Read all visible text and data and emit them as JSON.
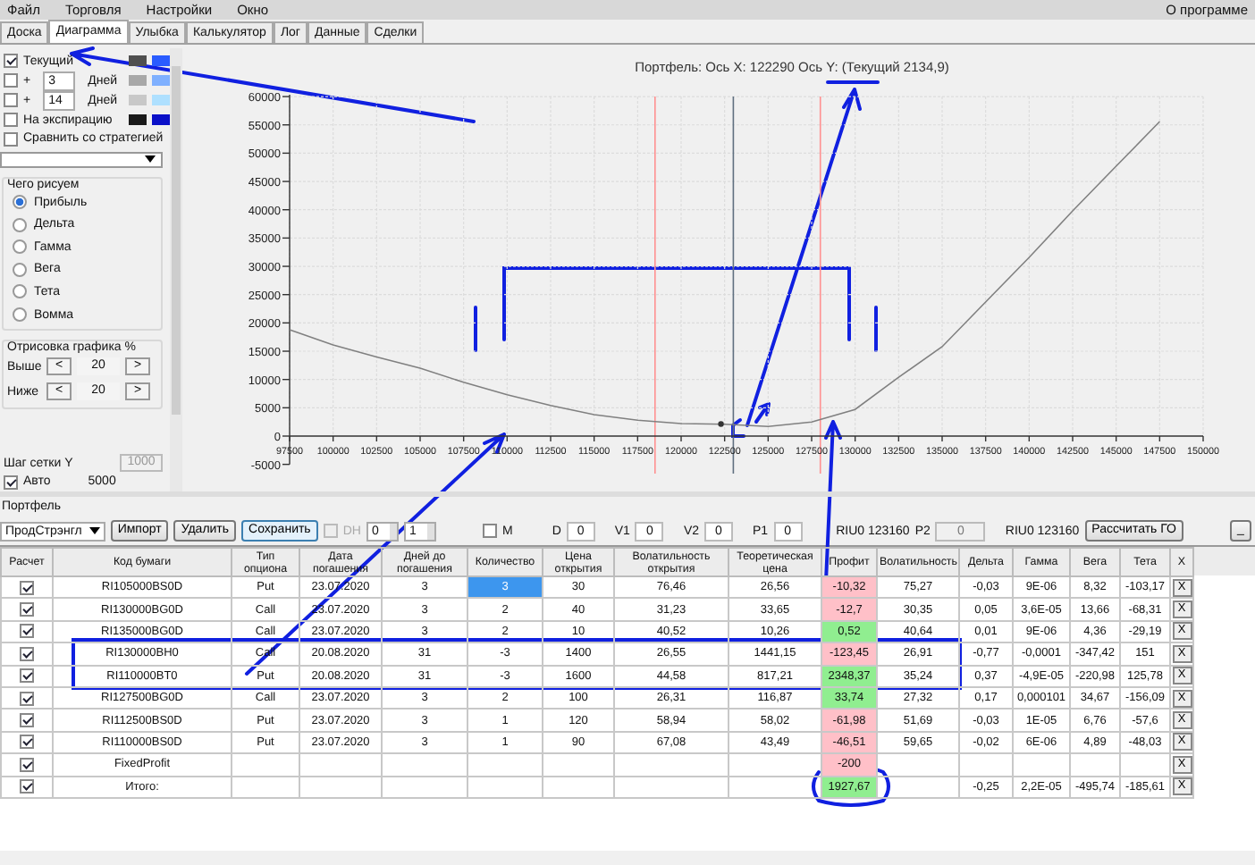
{
  "menu": [
    "Файл",
    "Торговля",
    "Настройки",
    "Окно"
  ],
  "menu_right": "О программе",
  "tabs": [
    {
      "label": "Доска",
      "selected": false
    },
    {
      "label": "Диаграмма",
      "selected": true
    },
    {
      "label": "Улыбка",
      "selected": false
    },
    {
      "label": "Калькулятор",
      "selected": false
    },
    {
      "label": "Лог",
      "selected": false
    },
    {
      "label": "Данные",
      "selected": false
    },
    {
      "label": "Сделки",
      "selected": false
    }
  ],
  "curves": [
    {
      "label": "Текущий",
      "checked": true,
      "swatches": [
        {
          "color": "#505050"
        },
        {
          "color": "#2a5cff"
        }
      ]
    },
    {
      "plus": "+",
      "days": "3",
      "unit": "Дней",
      "checked": false,
      "swatches": [
        {
          "color": "#a8a8a8"
        },
        {
          "color": "#7fb0ff"
        }
      ]
    },
    {
      "plus": "+",
      "days": "14",
      "unit": "Дней",
      "checked": false,
      "swatches": [
        {
          "color": "#c8c8c8"
        },
        {
          "color": "#aee0ff"
        }
      ]
    },
    {
      "label": "На экспирацию",
      "checked": false,
      "swatches": [
        {
          "color": "#1a1a1a"
        },
        {
          "color": "#0a10c8"
        }
      ]
    }
  ],
  "compare": {
    "label": "Сравнить со стратегией",
    "checked": false
  },
  "draw_group": {
    "title": "Чего рисуем",
    "options": [
      {
        "label": "Прибыль",
        "selected": true
      },
      {
        "label": "Дельта",
        "selected": false
      },
      {
        "label": "Гамма",
        "selected": false
      },
      {
        "label": "Вега",
        "selected": false
      },
      {
        "label": "Тета",
        "selected": false
      },
      {
        "label": "Вомма",
        "selected": false
      }
    ]
  },
  "range_group": {
    "title": "Отрисовка графика %",
    "rows": [
      {
        "label": "Выше",
        "dec": "<",
        "value": "20",
        "inc": ">"
      },
      {
        "label": "Ниже",
        "dec": "<",
        "value": "20",
        "inc": ">"
      }
    ]
  },
  "grid_step": {
    "label": "Шаг сетки Y",
    "value": "1000",
    "disabled": true,
    "auto_label": "Авто",
    "auto_checked": true,
    "auto_value": "5000"
  },
  "chart": {
    "chart_data": {
      "type": "line",
      "title": "Портфель: Ось X: 122290 Ось Y:  (Текущий 2134,9)",
      "x": [
        97500,
        100000,
        102500,
        105000,
        107500,
        110000,
        112500,
        115000,
        117500,
        120000,
        122500,
        125000,
        127500,
        130000,
        132500,
        135000,
        137500,
        140000,
        142500,
        145000,
        147500
      ],
      "grid": true,
      "ref_lines": [
        {
          "axis": "x",
          "value": 118500,
          "color": "#ff9090"
        },
        {
          "axis": "x",
          "value": 123000,
          "color": "#607080"
        },
        {
          "axis": "x",
          "value": 128000,
          "color": "#ff9090"
        }
      ],
      "series": [
        {
          "color": "#808080",
          "values": [
            18800,
            16100,
            14000,
            12000,
            9500,
            7300,
            5400,
            3800,
            2800,
            2200,
            2100,
            1700,
            2500,
            4700,
            10400,
            15800,
            23700,
            31600,
            39800,
            47700,
            55600
          ]
        }
      ],
      "xlim": [
        97500,
        150000
      ],
      "ylim": [
        -5000,
        60000
      ],
      "xticks": [
        97500,
        100000,
        102500,
        105000,
        107500,
        110000,
        112500,
        115000,
        117500,
        120000,
        122500,
        125000,
        127500,
        130000,
        132500,
        135000,
        137500,
        140000,
        142500,
        145000,
        147500,
        150000
      ],
      "yticks": [
        -5000,
        0,
        5000,
        10000,
        15000,
        20000,
        25000,
        30000,
        35000,
        40000,
        45000,
        50000,
        55000,
        60000
      ]
    }
  },
  "portfolio_label": "Портфель",
  "toolbar": {
    "strategy": "ПродСтрэнгл",
    "buttons": [
      {
        "label": "Импорт",
        "selected": false
      },
      {
        "label": "Удалить",
        "selected": false
      },
      {
        "label": "Сохранить",
        "selected": true
      }
    ],
    "dh": {
      "label": "DH",
      "checked": false,
      "disabled": true
    },
    "spins": [
      "0",
      "1"
    ],
    "m": {
      "label": "M",
      "checked": false
    },
    "params": [
      {
        "label": "D",
        "value": "0"
      },
      {
        "label": "V1",
        "value": "0"
      },
      {
        "label": "V2",
        "value": "0"
      },
      {
        "label": "P1",
        "value": "0"
      }
    ],
    "p1_asset": "RIU0 123160",
    "p2": {
      "label": "P2",
      "value": "0",
      "disabled": true
    },
    "p2_asset": "RIU0 123160",
    "calc_button": "Рассчитать ГО",
    "min_button": "_"
  },
  "table": {
    "columns": [
      "Расчет",
      "Код бумаги",
      "Тип опциона",
      "Дата погашения",
      "Дней до погашения",
      "Количество",
      "Цена открытия",
      "Волатильность открытия",
      "Теоретическая цена",
      "Профит",
      "Волатильность",
      "Дельта",
      "Гамма",
      "Вега",
      "Тета",
      "X"
    ],
    "rows": [
      {
        "calc": true,
        "code": "RI105000BS0D",
        "type": "Put",
        "date": "23.07.2020",
        "days": "3",
        "qty": "3",
        "price": "30",
        "vol_open": "76,46",
        "theo": "26,56",
        "profit": "-10,32",
        "color": "#ffc0c8",
        "vol": "75,27",
        "delta": "-0,03",
        "gamma": "9E-06",
        "vega": "8,32",
        "theta": "-103,17",
        "selected": true,
        "close": "X"
      },
      {
        "calc": true,
        "code": "RI130000BG0D",
        "type": "Call",
        "date": "23.07.2020",
        "days": "3",
        "qty": "2",
        "price": "40",
        "vol_open": "31,23",
        "theo": "33,65",
        "profit": "-12,7",
        "color": "#ffc0c8",
        "vol": "30,35",
        "delta": "0,05",
        "gamma": "3,6E-05",
        "vega": "13,66",
        "theta": "-68,31",
        "selected": false,
        "close": "X"
      },
      {
        "calc": true,
        "code": "RI135000BG0D",
        "type": "Call",
        "date": "23.07.2020",
        "days": "3",
        "qty": "2",
        "price": "10",
        "vol_open": "40,52",
        "theo": "10,26",
        "profit": "0,52",
        "color": "#90ee90",
        "vol": "40,64",
        "delta": "0,01",
        "gamma": "9E-06",
        "vega": "4,36",
        "theta": "-29,19",
        "selected": false,
        "close": "X"
      },
      {
        "calc": true,
        "code": "RI130000BH0",
        "type": "Call",
        "date": "20.08.2020",
        "days": "31",
        "qty": "-3",
        "price": "1400",
        "vol_open": "26,55",
        "theo": "1441,15",
        "profit": "-123,45",
        "color": "#ffc0c8",
        "vol": "26,91",
        "delta": "-0,77",
        "gamma": "-0,0001",
        "vega": "-347,42",
        "theta": "151",
        "selected": false,
        "close": "X"
      },
      {
        "calc": true,
        "code": "RI110000BT0",
        "type": "Put",
        "date": "20.08.2020",
        "days": "31",
        "qty": "-3",
        "price": "1600",
        "vol_open": "44,58",
        "theo": "817,21",
        "profit": "2348,37",
        "color": "#90ee90",
        "vol": "35,24",
        "delta": "0,37",
        "gamma": "-4,9E-05",
        "vega": "-220,98",
        "theta": "125,78",
        "selected": false,
        "close": "X"
      },
      {
        "calc": true,
        "code": "RI127500BG0D",
        "type": "Call",
        "date": "23.07.2020",
        "days": "3",
        "qty": "2",
        "price": "100",
        "vol_open": "26,31",
        "theo": "116,87",
        "profit": "33,74",
        "color": "#90ee90",
        "vol": "27,32",
        "delta": "0,17",
        "gamma": "0,000101",
        "vega": "34,67",
        "theta": "-156,09",
        "selected": false,
        "close": "X"
      },
      {
        "calc": true,
        "code": "RI112500BS0D",
        "type": "Put",
        "date": "23.07.2020",
        "days": "3",
        "qty": "1",
        "price": "120",
        "vol_open": "58,94",
        "theo": "58,02",
        "profit": "-61,98",
        "color": "#ffc0c8",
        "vol": "51,69",
        "delta": "-0,03",
        "gamma": "1E-05",
        "vega": "6,76",
        "theta": "-57,6",
        "selected": false,
        "close": "X"
      },
      {
        "calc": true,
        "code": "RI110000BS0D",
        "type": "Put",
        "date": "23.07.2020",
        "days": "3",
        "qty": "1",
        "price": "90",
        "vol_open": "67,08",
        "theo": "43,49",
        "profit": "-46,51",
        "color": "#ffc0c8",
        "vol": "59,65",
        "delta": "-0,02",
        "gamma": "6E-06",
        "vega": "4,89",
        "theta": "-48,03",
        "selected": false,
        "close": "X"
      },
      {
        "calc": true,
        "code": "FixedProfit",
        "profit": "-200",
        "color": "#ffc0c8",
        "selected": false,
        "close": "X"
      },
      {
        "calc": true,
        "code": "Итого:",
        "profit": "1927,67",
        "color": "#90ee90",
        "delta": "-0,25",
        "gamma": "2,2E-05",
        "vega": "-495,74",
        "theta": "-185,61",
        "selected": false,
        "close": "X"
      }
    ]
  }
}
